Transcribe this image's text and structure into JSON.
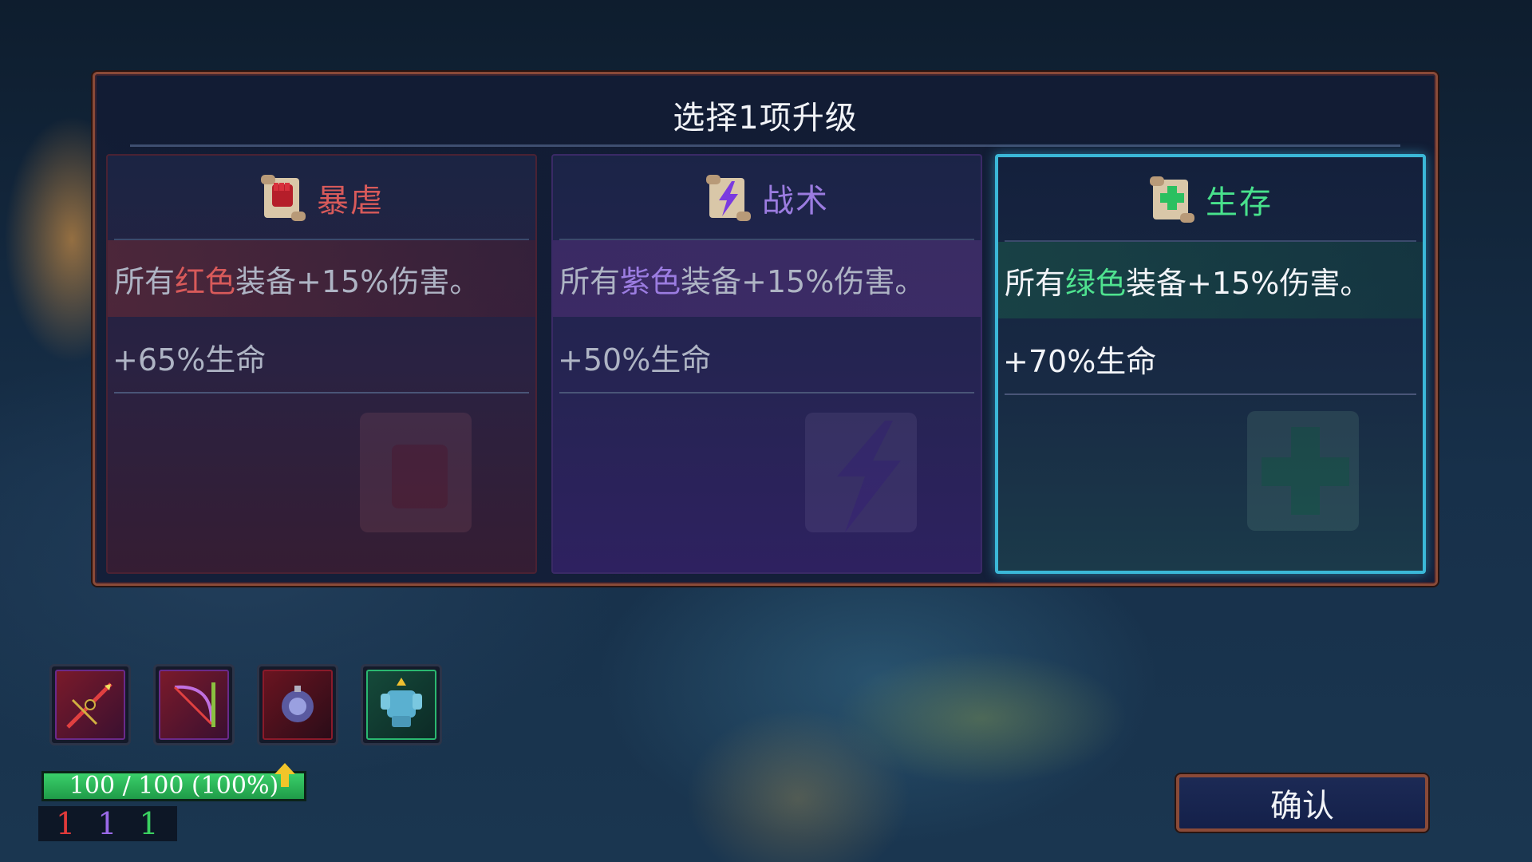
{
  "modal": {
    "title": "选择1项升级",
    "cards": [
      {
        "name": "暴虐",
        "desc_prefix": "所有",
        "desc_keyword": "红色",
        "desc_suffix": "装备+15%伤害。",
        "stat": "+65%生命",
        "color": "#d85a5a",
        "icon": "fist-scroll-icon",
        "selected": false
      },
      {
        "name": "战术",
        "desc_prefix": "所有",
        "desc_keyword": "紫色",
        "desc_suffix": "装备+15%伤害。",
        "stat": "+50%生命",
        "color": "#9b7ce0",
        "icon": "lightning-scroll-icon",
        "selected": false
      },
      {
        "name": "生存",
        "desc_prefix": "所有",
        "desc_keyword": "绿色",
        "desc_suffix": "装备+15%伤害。",
        "stat": "+70%生命",
        "color": "#48e28c",
        "icon": "cross-scroll-icon",
        "selected": true
      }
    ]
  },
  "inventory": [
    {
      "icon": "crossbow-icon"
    },
    {
      "icon": "bow-icon"
    },
    {
      "icon": "bomb-icon"
    },
    {
      "icon": "armor-icon"
    }
  ],
  "hud": {
    "health_text": "100 / 100 (100%)",
    "health_fraction": 1.0,
    "counts": [
      {
        "value": "1",
        "color": "#e03a3a"
      },
      {
        "value": "1",
        "color": "#9a6ae8"
      },
      {
        "value": "1",
        "color": "#3ad060"
      }
    ]
  },
  "confirm_label": "确认"
}
